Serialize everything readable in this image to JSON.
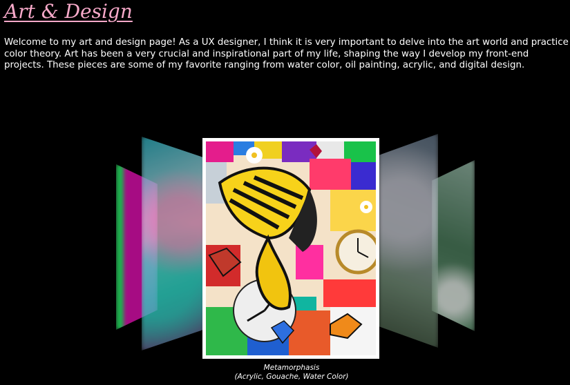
{
  "header": {
    "title": "Art & Design"
  },
  "intro": {
    "text": "Welcome to my art and design page! As a UX designer, I think it is very important to delve into the art world and practice color theory. Art has been a very crucial and inspirational part of my life, shaping the way I develop my front-end projects. These pieces are some of my favorite ranging from water color, oil painting, acrylic, and digital design."
  },
  "carousel": {
    "featured": {
      "title": "Metamorphasis",
      "medium": "(Acrylic, Gouache, Water Color)"
    }
  },
  "colors": {
    "background": "#000000",
    "title_accent": "#f7a9c9",
    "text": "#ffffff"
  }
}
